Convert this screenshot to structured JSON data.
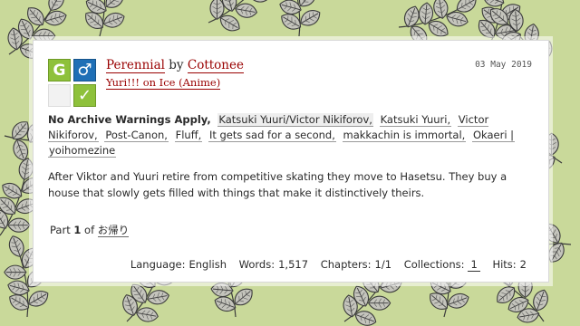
{
  "work": {
    "title": "Perennial",
    "by": "by",
    "author": "Cottonee",
    "fandom": "Yuri!!! on Ice (Anime)",
    "date": "03 May 2019",
    "icons": {
      "rating": "G",
      "category": "♂",
      "complete": "✓"
    },
    "warning": "No Archive Warnings Apply,",
    "tags": [
      "Katsuki Yuuri/Victor Nikiforov,",
      "Katsuki Yuuri,",
      "Victor Nikiforov,",
      "Post-Canon,",
      "Fluff,",
      "It gets sad for a second,",
      "makkachin is immortal,",
      "Okaeri |",
      "yoihomezine"
    ],
    "summary": "After Viktor and Yuuri retire from competitive skating they move to Hasetsu. They buy a house that slowly gets filled with things that make it distinctively theirs.",
    "series": {
      "part_label": "Part",
      "part_number": "1",
      "of_label": "of",
      "name": "お帰り"
    },
    "stats": {
      "language_label": "Language:",
      "language": "English",
      "words_label": "Words:",
      "words": "1,517",
      "chapters_label": "Chapters:",
      "chapters": "1/1",
      "collections_label": "Collections:",
      "collections": "1",
      "hits_label": "Hits:",
      "hits": "2"
    }
  },
  "colors": {
    "background": "#c9d99a",
    "link": "#990000",
    "rating_green": "#8ec13b",
    "category_blue": "#1f6fb6"
  }
}
